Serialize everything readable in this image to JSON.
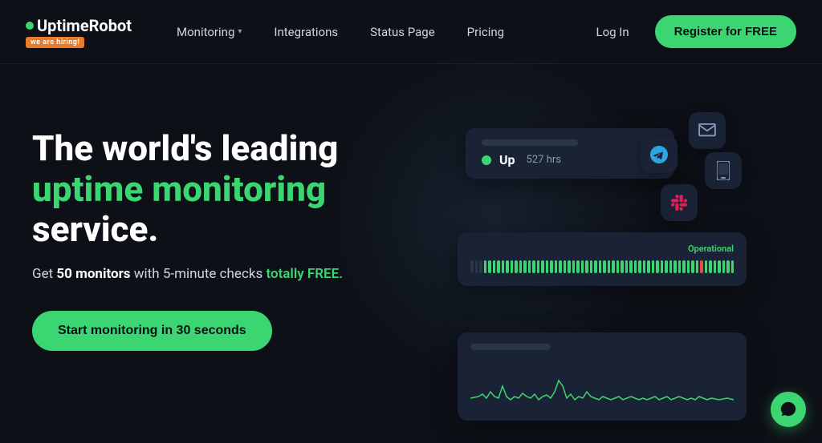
{
  "nav": {
    "logo": {
      "dot_color": "#3bd671",
      "name": "UptimeRobot",
      "badge": "we are hiring!"
    },
    "links": [
      {
        "label": "Monitoring",
        "has_dropdown": true
      },
      {
        "label": "Integrations",
        "has_dropdown": false
      },
      {
        "label": "Status Page",
        "has_dropdown": false
      },
      {
        "label": "Pricing",
        "has_dropdown": false
      }
    ],
    "login_label": "Log In",
    "register_label": "Register for FREE"
  },
  "hero": {
    "title_line1": "The world's leading",
    "title_green": "uptime monitoring",
    "title_line2": " service.",
    "subtitle": "Get 50 monitors with 5-minute checks totally FREE.",
    "cta_label": "Start monitoring in 30 seconds"
  },
  "dashboard": {
    "card_up": {
      "status": "Up",
      "hours": "527 hrs"
    },
    "status_card": {
      "badge": "Operational"
    },
    "icons": {
      "telegram": "✈",
      "email": "✉",
      "mobile": "📱",
      "slack": "slack"
    }
  },
  "chat_icon": "💬"
}
